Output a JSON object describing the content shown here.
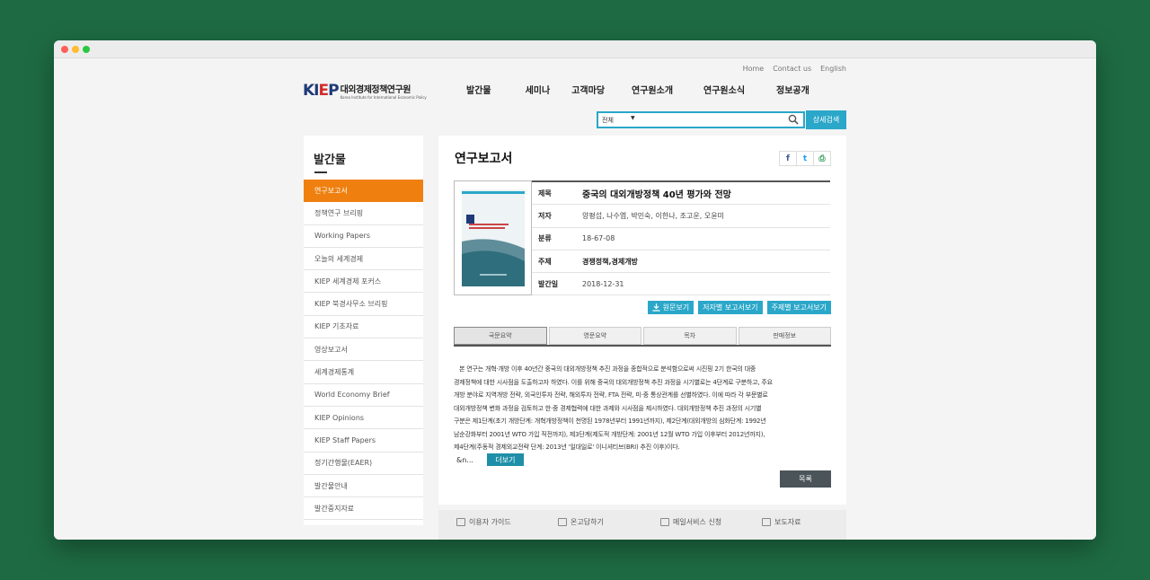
{
  "top_links": [
    "Home",
    "Contact us",
    "English"
  ],
  "logo": {
    "mark_k": "KI",
    "mark_e": "E",
    "mark_p": "P",
    "ko": "대외경제정책연구원",
    "en": "Korea Institute for International Economic Policy"
  },
  "gnb": [
    "발간물",
    "세미나",
    "고객마당",
    "연구원소개",
    "연구원소식",
    "정보공개"
  ],
  "search": {
    "select": "전체",
    "caret": "▼",
    "detail_button": "상세검색"
  },
  "sidebar": {
    "title": "발간물",
    "items": [
      "연구보고서",
      "정책연구 브리핑",
      "Working Papers",
      "오늘의 세계경제",
      "KIEP 세계경제 포커스",
      "KIEP 북경사무소 브리핑",
      "KIEP 기초자료",
      "영상보고서",
      "세계경제통계",
      "World Economy Brief",
      "KIEP Opinions",
      "KIEP Staff Papers",
      "정기간행물(EAER)",
      "발간물안내",
      "발간중지자료"
    ]
  },
  "content": {
    "title": "연구보고서",
    "share": {
      "facebook": "f",
      "twitter": "t",
      "print": "⎙"
    },
    "meta": [
      {
        "key": "제목",
        "value": "중국의 대외개방정책 40년 평가와 전망"
      },
      {
        "key": "저자",
        "value": "양평섭, 나수엽, 박민숙, 이한나, 조고운, 오윤미"
      },
      {
        "key": "분류",
        "value": "18-67-08"
      },
      {
        "key": "주제",
        "value": "경쟁정책,경제개방"
      },
      {
        "key": "발간일",
        "value": "2018-12-31"
      }
    ],
    "actions": [
      "원문보기",
      "저자별 보고서보기",
      "주제별 보고서보기"
    ],
    "tabs": [
      "국문요약",
      "영문요약",
      "목차",
      "판매정보"
    ],
    "abstract": [
      "본 연구는 개혁·개방 이후 40년간 중국의 대외개방정책 추진 과정을 종합적으로 분석함으로써 시진핑 2기 한국의 대중",
      "경제정책에 대한 시사점을 도출하고자 하였다. 이를 위해 중국의 대외개방정책 추진 과정을 시기별로는 4단계로 구분하고, 주요",
      "개방 분야로 지역개방 전략, 외국인투자 전략, 해외투자 전략, FTA 전략, 미·중 통상관계를 선별하였다. 이에 따라 각 부문별로",
      "대외개방정책 변화 과정을 검토하고 한·중 경제협력에 대한 과제와 시사점을 제시하였다. 대외개방정책 추진 과정의 시기별",
      "구분은 제1단계(초기 개방단계: 개혁개방정책이 천명된 1978년부터 1991년까지), 제2단계(대외개방의 심화단계: 1992년",
      "남순강화부터 2001년 WTO 가입 직전까지), 제3단계(제도적 개방단계: 2001년 12월 WTO 가입 이후부터 2012년까지),",
      "제4단계(주동적 경제외교전략 단계: 2013년 '일대일로' 이니셔티브(BRI) 추진 이후)이다."
    ],
    "more_text": "&n...",
    "more_button": "더보기",
    "list_button": "목록"
  },
  "footer": [
    "이용자 가이드",
    "온고답하기",
    "메일서비스 신청",
    "보도자료"
  ],
  "colors": {
    "accent_blue": "#2aa7c9",
    "active_orange": "#ef8010",
    "background_green": "#1e6b43"
  }
}
